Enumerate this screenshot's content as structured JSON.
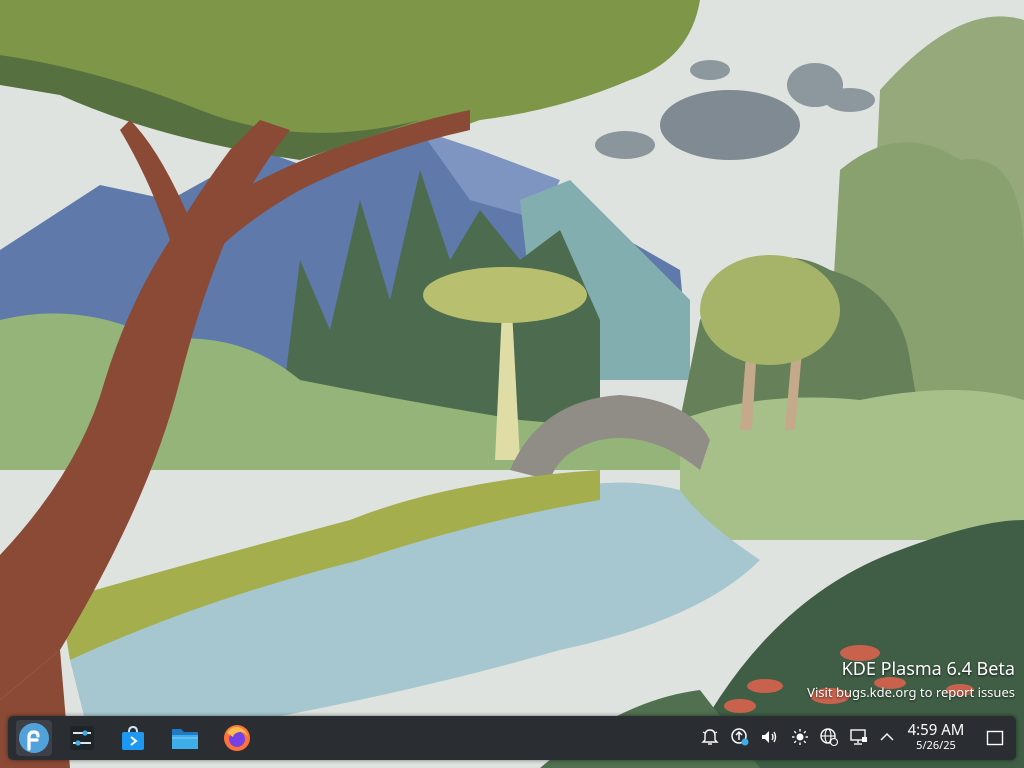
{
  "watermark": {
    "title": "KDE Plasma 6.4 Beta",
    "subtitle": "Visit bugs.kde.org to report issues"
  },
  "taskbar": {
    "launchers": [
      {
        "name": "application-launcher",
        "icon": "fedora-icon"
      },
      {
        "name": "system-settings",
        "icon": "sliders-icon"
      },
      {
        "name": "discover",
        "icon": "store-bag-icon"
      },
      {
        "name": "dolphin",
        "icon": "folder-icon"
      },
      {
        "name": "firefox",
        "icon": "firefox-icon"
      }
    ],
    "tray_icons": [
      "bell-icon",
      "update-icon",
      "volume-icon",
      "brightness-icon",
      "globe-icon",
      "network-wired-icon",
      "chevron-up-icon"
    ],
    "clock": {
      "time": "4:59 AM",
      "date": "5/26/25"
    },
    "show_desktop_icon": "show-desktop-icon"
  },
  "colors": {
    "panel": "#2a2e32",
    "accent": "#3daee9",
    "fedora": "#51a2da",
    "firefox": "#ff7139"
  }
}
